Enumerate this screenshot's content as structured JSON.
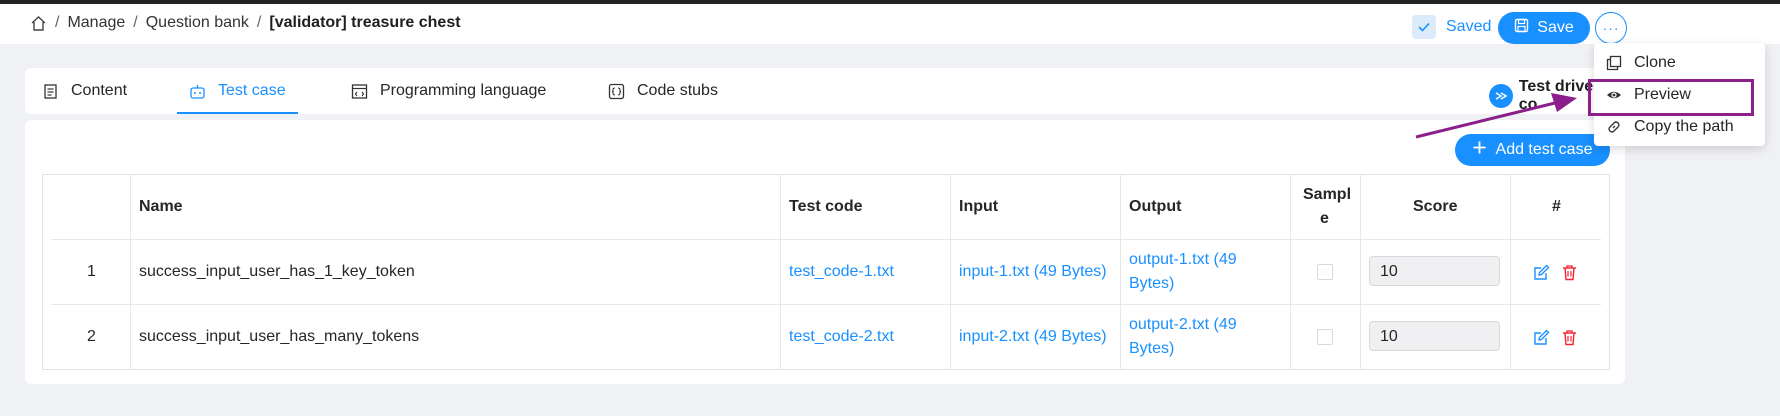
{
  "breadcrumb": {
    "items": [
      "Manage",
      "Question bank"
    ],
    "current": "[validator] treasure chest"
  },
  "header": {
    "saved_label": "Saved",
    "save_label": "Save",
    "more_label": "···"
  },
  "menu": {
    "items": [
      {
        "label": "Clone",
        "icon": "copy-icon"
      },
      {
        "label": "Preview",
        "icon": "eye-icon"
      },
      {
        "label": "Copy the path",
        "icon": "link-icon"
      }
    ]
  },
  "tabs": [
    {
      "label": "Content",
      "icon": "document-icon",
      "active": false
    },
    {
      "label": "Test case",
      "icon": "robot-icon",
      "active": true
    },
    {
      "label": "Programming language",
      "icon": "code-window-icon",
      "active": false
    },
    {
      "label": "Code stubs",
      "icon": "code-braces-icon",
      "active": false
    }
  ],
  "test_driven_label": "Test driven co",
  "add_test_case_label": "Add test case",
  "table": {
    "headers": {
      "name": "Name",
      "test_code": "Test code",
      "input": "Input",
      "output": "Output",
      "sample_line1": "Sampl",
      "sample_line2": "e",
      "score": "Score",
      "hash": "#"
    },
    "rows": [
      {
        "index": "1",
        "name": "success_input_user_has_1_key_token",
        "test_code": "test_code-1.txt",
        "input": "input-1.txt (49 Bytes)",
        "output_line1": "output-1.txt (49",
        "output_line2": "Bytes)",
        "sample": false,
        "score": "10"
      },
      {
        "index": "2",
        "name": "success_input_user_has_many_tokens",
        "test_code": "test_code-2.txt",
        "input": "input-2.txt (49 Bytes)",
        "output_line1": "output-2.txt (49",
        "output_line2": "Bytes)",
        "sample": false,
        "score": "10"
      }
    ]
  },
  "colors": {
    "accent": "#1890ff",
    "annotation": "#8b1f8b",
    "danger": "#f5222d"
  }
}
